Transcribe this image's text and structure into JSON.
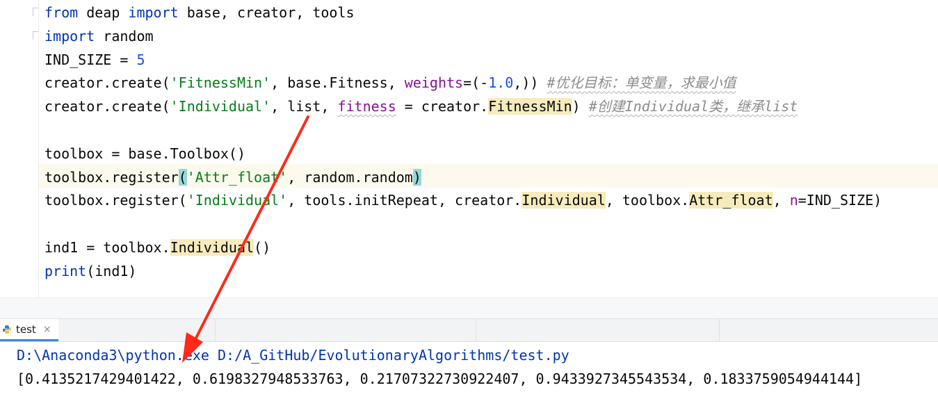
{
  "editor": {
    "lines": [
      {
        "parts": [
          [
            "kw",
            "from"
          ],
          [
            "",
            " deap "
          ],
          [
            "kw",
            "import"
          ],
          [
            "",
            " base, creator, tools"
          ]
        ]
      },
      {
        "parts": [
          [
            "kw",
            "import"
          ],
          [
            "",
            " random"
          ]
        ]
      },
      {
        "parts": [
          [
            "",
            "IND_SIZE = "
          ],
          [
            "num",
            "5"
          ]
        ]
      },
      {
        "parts": [
          [
            "",
            "creator.create("
          ],
          [
            "str",
            "'FitnessMin'"
          ],
          [
            "",
            ", base.Fitness, "
          ],
          [
            "param",
            "weights"
          ],
          [
            "",
            "=(-"
          ],
          [
            "num",
            "1.0"
          ],
          [
            "",
            ",)) "
          ],
          [
            "cmt squig",
            "#优化目标：单变量，求最小值"
          ]
        ]
      },
      {
        "parts": [
          [
            "",
            "creator.create("
          ],
          [
            "str",
            "'Individual'"
          ],
          [
            "",
            ", list, "
          ],
          [
            "param squig",
            "fitness"
          ],
          [
            "",
            " = creator."
          ],
          [
            "hl",
            "FitnessMin"
          ],
          [
            "",
            ") "
          ],
          [
            "cmt squig",
            "#创建Individual类，继承list"
          ]
        ]
      },
      {
        "parts": []
      },
      {
        "parts": [
          [
            "",
            "toolbox = base.Toolbox()"
          ]
        ]
      },
      {
        "parts": [
          [
            "",
            "toolbox.register"
          ],
          [
            "brace",
            "("
          ],
          [
            "str",
            "'Attr_float'"
          ],
          [
            "",
            ", random.random"
          ],
          [
            "brace",
            ")"
          ]
        ]
      },
      {
        "parts": [
          [
            "",
            "toolbox.register("
          ],
          [
            "str",
            "'Individual'"
          ],
          [
            "",
            ", tools.initRepeat, creator."
          ],
          [
            "hl",
            "Individual"
          ],
          [
            "",
            ", toolbox."
          ],
          [
            "hl",
            "Attr_float"
          ],
          [
            "",
            ", "
          ],
          [
            "param",
            "n"
          ],
          [
            "",
            "=IND_SIZE)"
          ]
        ]
      },
      {
        "parts": []
      },
      {
        "parts": [
          [
            "",
            "ind1 = toolbox."
          ],
          [
            "hl",
            "Individual"
          ],
          [
            "",
            "()"
          ]
        ]
      },
      {
        "parts": [
          [
            "kw",
            "print"
          ],
          [
            "",
            "(ind1)"
          ]
        ]
      }
    ]
  },
  "run_panel": {
    "tab_label": "test",
    "tab_close": "×",
    "command": "D:\\Anaconda3\\python.exe D:/A_GitHub/EvolutionaryAlgorithms/test.py",
    "output": "[0.4135217429401422, 0.6198327948533763, 0.21707322730922407, 0.9433927345543534, 0.1833759054944144]"
  },
  "colors": {
    "keyword": "#0033b3",
    "string": "#067d17",
    "number": "#1750eb",
    "comment": "#8c8c8c",
    "annotation_arrow": "#ff2a1a"
  }
}
